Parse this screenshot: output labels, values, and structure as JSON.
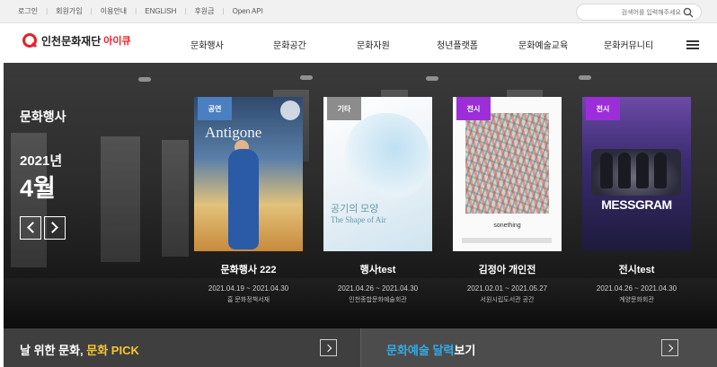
{
  "util_links": [
    "로그인",
    "회원가입",
    "이용안내",
    "ENGLISH",
    "후원금",
    "Open API"
  ],
  "search": {
    "placeholder": "검색어를 입력해주세요"
  },
  "logo": {
    "name": "인천문화재단",
    "sub": "아이큐",
    "brand_color": "#e8202a"
  },
  "nav": [
    "문화행사",
    "문화공간",
    "문화자원",
    "청년플랫폼",
    "문화예술교육",
    "문화커뮤니티"
  ],
  "hero": {
    "section": "문화행사",
    "year": "2021년",
    "month": "4월"
  },
  "cards": [
    {
      "badge": "공연",
      "badge_color": "#4a7fc1",
      "title": "문화행사 222",
      "date": "2021.04.19 ~ 2021.04.30",
      "venue": "흡 문화정책서재",
      "poster_title": "Antigone"
    },
    {
      "badge": "기타",
      "badge_color": "#8c8c8c",
      "title": "행사test",
      "date": "2021.04.26 ~ 2021.04.30",
      "venue": "인천종합문화예술회관",
      "poster_title": "공기의 모양",
      "poster_sub": "The Shape of Air"
    },
    {
      "badge": "전시",
      "badge_color": "#9b2ed8",
      "title": "김정아 개인전",
      "date": "2021.02.01 ~ 2021.05.27",
      "venue": "서원시립도서관 공간",
      "poster_title": "sonething"
    },
    {
      "badge": "전시",
      "badge_color": "#9b2ed8",
      "title": "전시test",
      "date": "2021.04.26 ~ 2021.04.30",
      "venue": "계양문화회관",
      "poster_title": "MESSGRAM"
    }
  ],
  "bottom": {
    "left": {
      "prefix": "날 위한 문화, ",
      "highlight": "문화 PICK",
      "highlight_color": "#f7c531"
    },
    "right": {
      "highlight": "문화예술 달력",
      "suffix": "보기",
      "highlight_color": "#35a9e6"
    }
  }
}
